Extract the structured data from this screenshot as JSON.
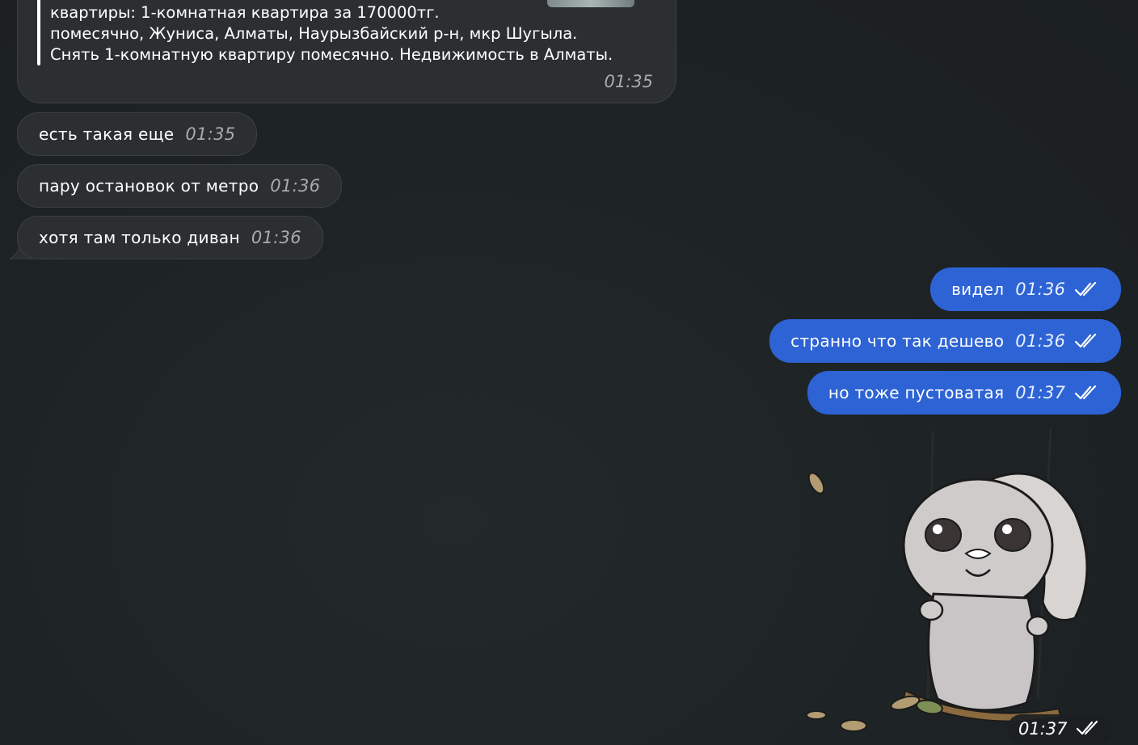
{
  "preview": {
    "text": "квартиры: 1-комнатная квартира за 170000тг.\nпомесячно, Жуниса, Алматы, Наурызбайский р-н, мкр Шугыла.\nСнять 1-комнатную квартиру помесячно. Недвижимость в Алматы.",
    "time": "01:35"
  },
  "incoming": [
    {
      "text": "есть такая еще",
      "time": "01:35"
    },
    {
      "text": "пару остановок от метро",
      "time": "01:36"
    },
    {
      "text": "хотя там только диван",
      "time": "01:36"
    }
  ],
  "outgoing": [
    {
      "text": "видел",
      "time": "01:36",
      "status": "read"
    },
    {
      "text": "странно что так дешево",
      "time": "01:36",
      "status": "read"
    },
    {
      "text": "но тоже пустоватая",
      "time": "01:37",
      "status": "read"
    }
  ],
  "sticker": {
    "icon": "bunny-on-swing-sticker",
    "time": "01:37",
    "status": "read"
  },
  "colors": {
    "background": "#1e2325",
    "incoming_bubble": "#2c2f31",
    "outgoing_bubble": "#2d63d4"
  }
}
